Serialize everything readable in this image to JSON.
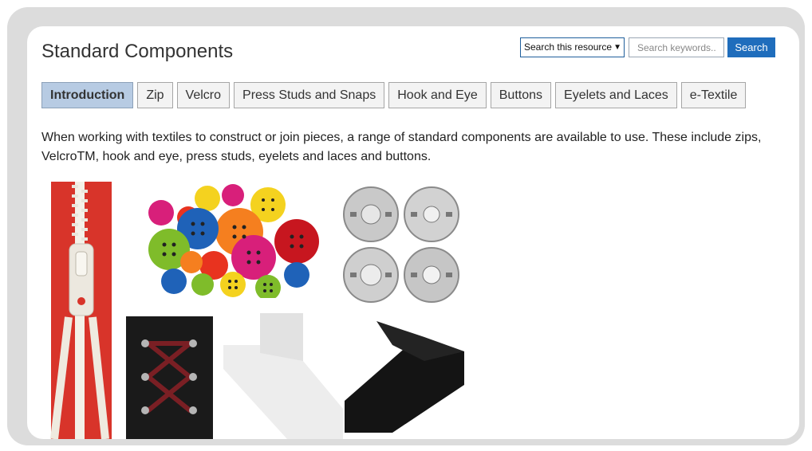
{
  "page": {
    "title": "Standard Components"
  },
  "search": {
    "scope_selected": "Search this resource",
    "placeholder": "Search keywords..",
    "button_label": "Search"
  },
  "tabs": [
    {
      "label": "Introduction",
      "active": true
    },
    {
      "label": "Zip",
      "active": false
    },
    {
      "label": "Velcro",
      "active": false
    },
    {
      "label": "Press Studs and Snaps",
      "active": false
    },
    {
      "label": "Hook and Eye",
      "active": false
    },
    {
      "label": "Buttons",
      "active": false
    },
    {
      "label": "Eyelets and Laces",
      "active": false
    },
    {
      "label": "e-Textile",
      "active": false
    }
  ],
  "content": {
    "intro_text": "When working with textiles to construct or join pieces, a range of standard components are available to use. These include zips, VelcroTM, hook and eye, press studs, eyelets and laces and buttons."
  },
  "colors": {
    "accent": "#1f6dbc",
    "active_tab": "#b7cbe3",
    "frame": "#dcdcdc"
  },
  "images": [
    {
      "name": "zip-image"
    },
    {
      "name": "buttons-image"
    },
    {
      "name": "press-studs-image"
    },
    {
      "name": "eyelets-laces-image"
    },
    {
      "name": "white-velcro-image"
    },
    {
      "name": "black-velcro-image"
    }
  ]
}
